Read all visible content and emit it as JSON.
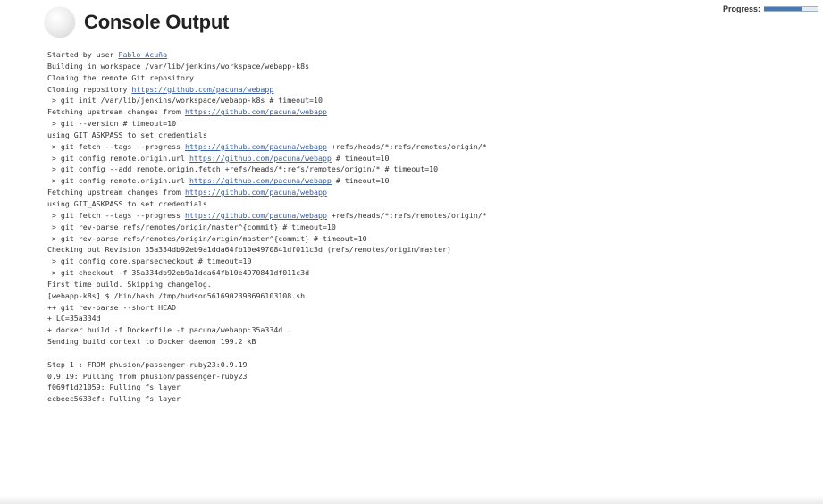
{
  "header": {
    "title": "Console Output"
  },
  "progress": {
    "label": "Progress:",
    "percent": 70
  },
  "console": {
    "lines": [
      {
        "segments": [
          {
            "text": "Started by user "
          },
          {
            "text": "Pablo Acuña",
            "link": true
          }
        ]
      },
      {
        "segments": [
          {
            "text": "Building in workspace /var/lib/jenkins/workspace/webapp-k8s"
          }
        ]
      },
      {
        "segments": [
          {
            "text": "Cloning the remote Git repository"
          }
        ]
      },
      {
        "segments": [
          {
            "text": "Cloning repository "
          },
          {
            "text": "https://github.com/pacuna/webapp",
            "link": true
          }
        ]
      },
      {
        "segments": [
          {
            "text": " > git init /var/lib/jenkins/workspace/webapp-k8s # timeout=10"
          }
        ]
      },
      {
        "segments": [
          {
            "text": "Fetching upstream changes from "
          },
          {
            "text": "https://github.com/pacuna/webapp",
            "link": true
          }
        ]
      },
      {
        "segments": [
          {
            "text": " > git --version # timeout=10"
          }
        ]
      },
      {
        "segments": [
          {
            "text": "using GIT_ASKPASS to set credentials"
          }
        ]
      },
      {
        "segments": [
          {
            "text": " > git fetch --tags --progress "
          },
          {
            "text": "https://github.com/pacuna/webapp",
            "link": true
          },
          {
            "text": " +refs/heads/*:refs/remotes/origin/*"
          }
        ]
      },
      {
        "segments": [
          {
            "text": " > git config remote.origin.url "
          },
          {
            "text": "https://github.com/pacuna/webapp",
            "link": true
          },
          {
            "text": " # timeout=10"
          }
        ]
      },
      {
        "segments": [
          {
            "text": " > git config --add remote.origin.fetch +refs/heads/*:refs/remotes/origin/* # timeout=10"
          }
        ]
      },
      {
        "segments": [
          {
            "text": " > git config remote.origin.url "
          },
          {
            "text": "https://github.com/pacuna/webapp",
            "link": true
          },
          {
            "text": " # timeout=10"
          }
        ]
      },
      {
        "segments": [
          {
            "text": "Fetching upstream changes from "
          },
          {
            "text": "https://github.com/pacuna/webapp",
            "link": true
          }
        ]
      },
      {
        "segments": [
          {
            "text": "using GIT_ASKPASS to set credentials"
          }
        ]
      },
      {
        "segments": [
          {
            "text": " > git fetch --tags --progress "
          },
          {
            "text": "https://github.com/pacuna/webapp",
            "link": true
          },
          {
            "text": " +refs/heads/*:refs/remotes/origin/*"
          }
        ]
      },
      {
        "segments": [
          {
            "text": " > git rev-parse refs/remotes/origin/master^{commit} # timeout=10"
          }
        ]
      },
      {
        "segments": [
          {
            "text": " > git rev-parse refs/remotes/origin/origin/master^{commit} # timeout=10"
          }
        ]
      },
      {
        "segments": [
          {
            "text": "Checking out Revision 35a334db92eb9a1dda64fb10e4970841df011c3d (refs/remotes/origin/master)"
          }
        ]
      },
      {
        "segments": [
          {
            "text": " > git config core.sparsecheckout # timeout=10"
          }
        ]
      },
      {
        "segments": [
          {
            "text": " > git checkout -f 35a334db92eb9a1dda64fb10e4970841df011c3d"
          }
        ]
      },
      {
        "segments": [
          {
            "text": "First time build. Skipping changelog."
          }
        ]
      },
      {
        "segments": [
          {
            "text": "[webapp-k8s] $ /bin/bash /tmp/hudson5616902398696103108.sh"
          }
        ]
      },
      {
        "segments": [
          {
            "text": "++ git rev-parse --short HEAD"
          }
        ]
      },
      {
        "segments": [
          {
            "text": "+ LC=35a334d"
          }
        ]
      },
      {
        "segments": [
          {
            "text": "+ docker build -f Dockerfile -t pacuna/webapp:35a334d ."
          }
        ]
      },
      {
        "segments": [
          {
            "text": "Sending build context to Docker daemon 199.2 kB"
          }
        ]
      },
      {
        "segments": [
          {
            "text": ""
          }
        ]
      },
      {
        "segments": [
          {
            "text": "Step 1 : FROM phusion/passenger-ruby23:0.9.19"
          }
        ]
      },
      {
        "segments": [
          {
            "text": "0.9.19: Pulling from phusion/passenger-ruby23"
          }
        ]
      },
      {
        "segments": [
          {
            "text": "f069f1d21059: Pulling fs layer"
          }
        ]
      },
      {
        "segments": [
          {
            "text": "ecbeec5633cf: Pulling fs layer"
          }
        ]
      }
    ]
  }
}
